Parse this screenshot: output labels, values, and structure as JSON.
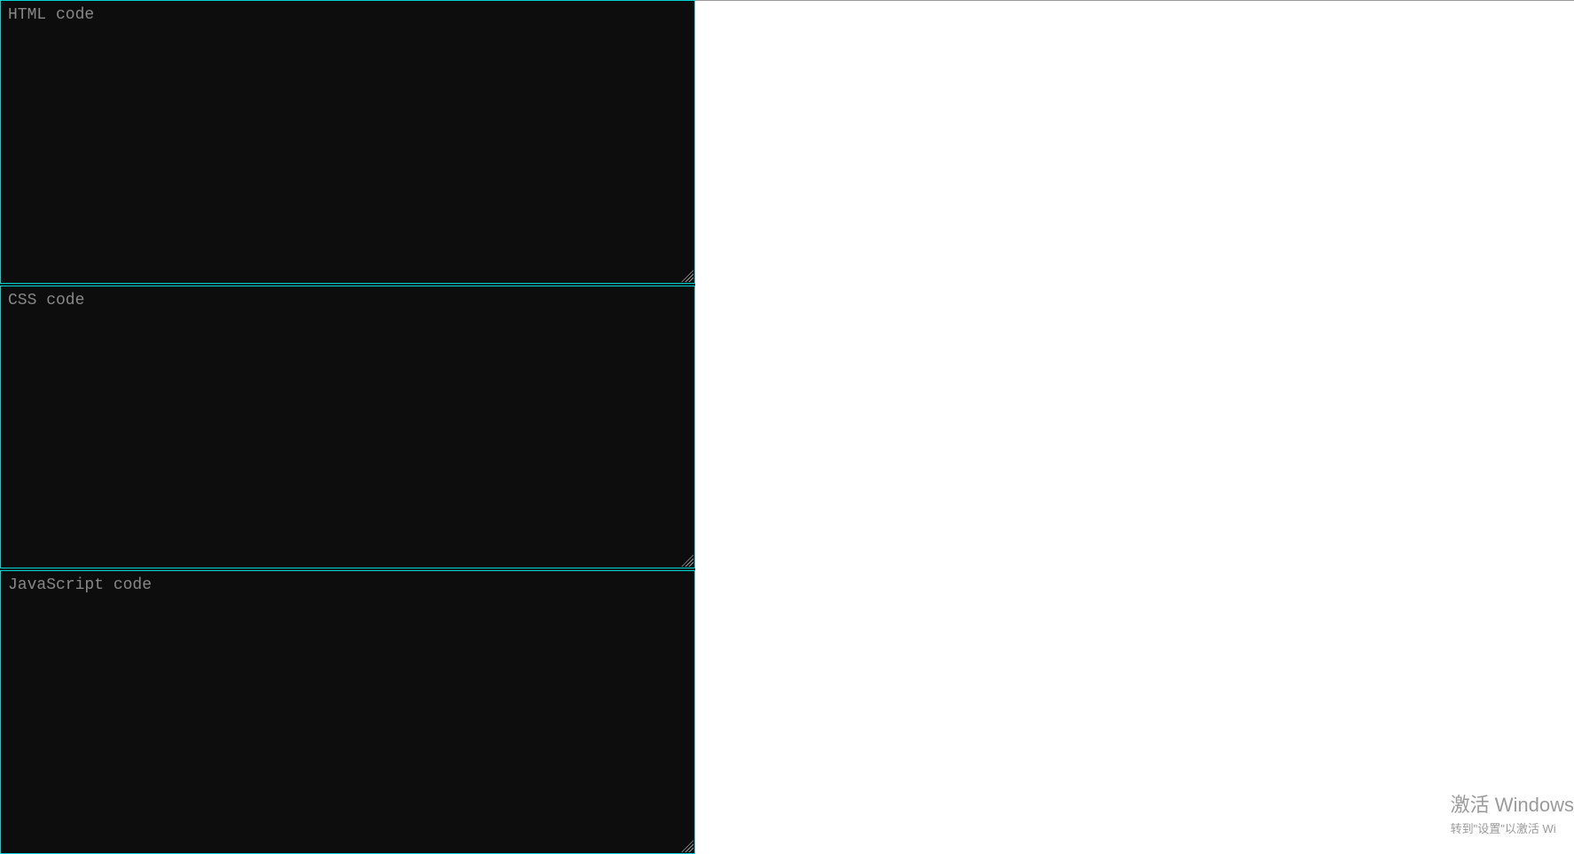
{
  "editors": {
    "html": {
      "placeholder": "HTML code",
      "value": ""
    },
    "css": {
      "placeholder": "CSS code",
      "value": ""
    },
    "javascript": {
      "placeholder": "JavaScript code",
      "value": ""
    }
  },
  "watermark": {
    "title": "激活 Windows",
    "subtitle": "转到\"设置\"以激活 Wi"
  }
}
